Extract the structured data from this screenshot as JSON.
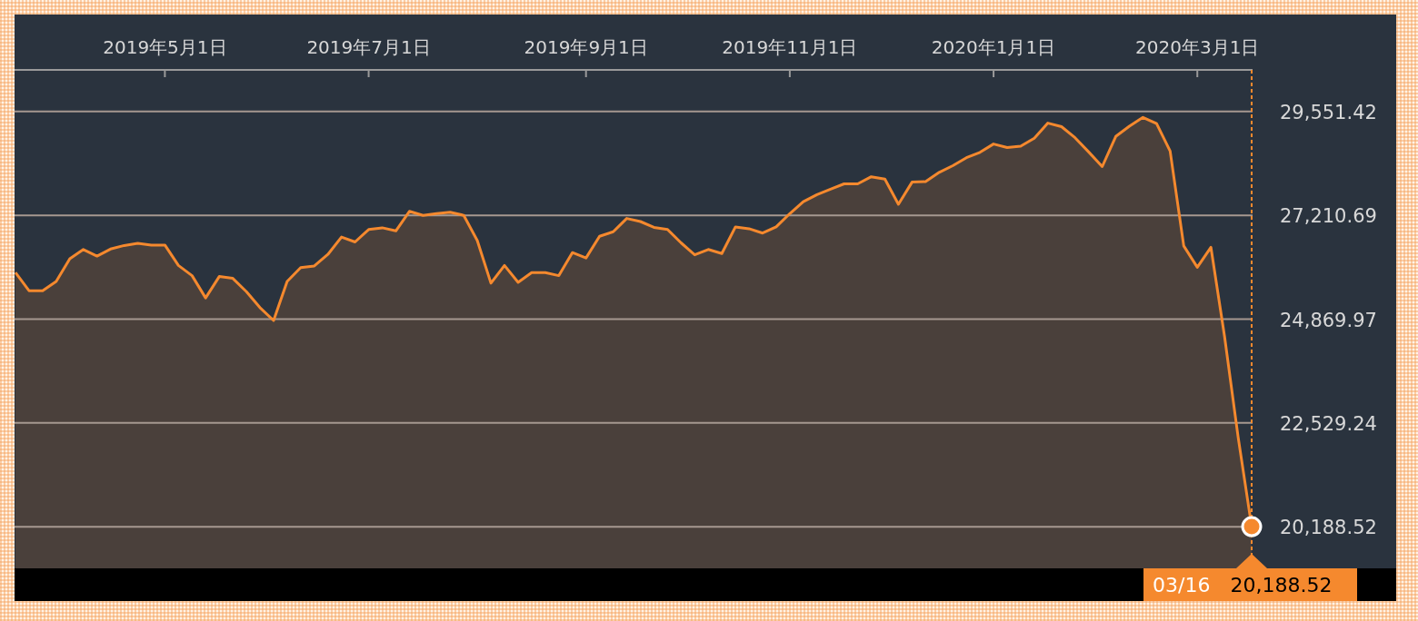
{
  "chart": {
    "chart_data": {
      "type": "area",
      "grid": true,
      "categories": [
        null,
        null,
        null,
        null,
        null,
        null,
        null,
        null,
        null,
        null,
        null,
        "2019年5月1日",
        null,
        null,
        null,
        null,
        null,
        null,
        null,
        null,
        null,
        null,
        null,
        null,
        null,
        null,
        "2019年7月1日",
        null,
        null,
        null,
        null,
        null,
        null,
        null,
        null,
        null,
        null,
        null,
        null,
        null,
        null,
        null,
        "2019年9月1日",
        null,
        null,
        null,
        null,
        null,
        null,
        null,
        null,
        null,
        null,
        null,
        null,
        null,
        null,
        "2019年11月1日",
        null,
        null,
        null,
        null,
        null,
        null,
        null,
        null,
        null,
        null,
        null,
        null,
        null,
        null,
        "2020年1月1日",
        null,
        null,
        null,
        null,
        null,
        null,
        null,
        null,
        null,
        null,
        null,
        null,
        null,
        null,
        "2020年3月1日",
        null,
        null,
        null,
        null
      ],
      "series": [
        {
          "color": "#f5892e",
          "values": [
            25920,
            25510,
            25510,
            25720,
            26230,
            26440,
            26290,
            26450,
            26530,
            26580,
            26540,
            26540,
            26080,
            25850,
            25350,
            25830,
            25790,
            25490,
            25130,
            24840,
            25720,
            26030,
            26070,
            26330,
            26720,
            26610,
            26890,
            26930,
            26860,
            27300,
            27210,
            27250,
            27280,
            27210,
            26640,
            25680,
            26080,
            25700,
            25920,
            25920,
            25850,
            26370,
            26250,
            26740,
            26840,
            27140,
            27070,
            26940,
            26890,
            26590,
            26320,
            26440,
            26350,
            26950,
            26910,
            26810,
            26950,
            27250,
            27520,
            27680,
            27800,
            27920,
            27920,
            28080,
            28030,
            27460,
            27960,
            27970,
            28180,
            28330,
            28510,
            28630,
            28820,
            28740,
            28770,
            28950,
            29290,
            29210,
            28960,
            28640,
            28310,
            28990,
            29220,
            29420,
            29280,
            28660,
            26520,
            26040,
            26490,
            24490,
            22210,
            20190
          ]
        }
      ],
      "ylim": [
        19250,
        30490
      ],
      "yticks": [
        {
          "value": 29551.42,
          "label": "29,551.42"
        },
        {
          "value": 27210.69,
          "label": "27,210.69"
        },
        {
          "value": 24869.97,
          "label": "24,869.97"
        },
        {
          "value": 22529.24,
          "label": "22,529.24"
        },
        {
          "value": 20188.52,
          "label": "20,188.52"
        }
      ]
    }
  },
  "tooltip": {
    "date": "03/16",
    "value": "20,188.52"
  }
}
